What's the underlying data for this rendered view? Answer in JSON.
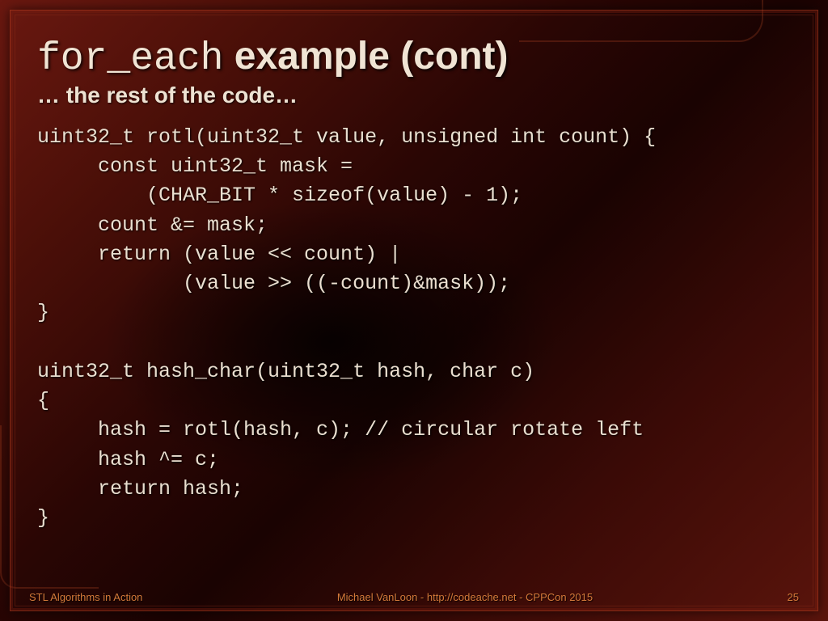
{
  "title_mono": "for_each",
  "title_rest": " example (cont)",
  "subtitle": "… the rest of the code…",
  "code": "uint32_t rotl(uint32_t value, unsigned int count) {\n     const uint32_t mask =\n         (CHAR_BIT * sizeof(value) - 1);\n     count &= mask;\n     return (value << count) |\n            (value >> ((-count)&mask));\n}\n\nuint32_t hash_char(uint32_t hash, char c)\n{\n     hash = rotl(hash, c); // circular rotate left\n     hash ^= c;\n     return hash;\n}",
  "footer": {
    "left": "STL Algorithms in Action",
    "center": "Michael VanLoon - http://codeache.net - CPPCon 2015",
    "right": "25"
  }
}
